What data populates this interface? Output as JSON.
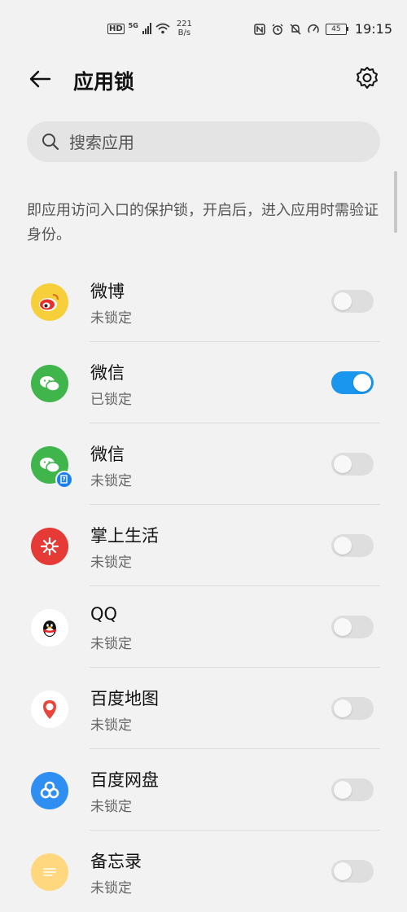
{
  "status_bar": {
    "hd": "HD",
    "network": "5G",
    "speed_value": "221",
    "speed_unit": "B/s",
    "battery": "45",
    "time": "19:15"
  },
  "header": {
    "title": "应用锁"
  },
  "search": {
    "placeholder": "搜索应用"
  },
  "description": "即应用访问入口的保护锁，开启后，进入应用时需验证身份。",
  "apps": [
    {
      "name": "微博",
      "status": "未锁定",
      "locked": false,
      "icon": "weibo-icon",
      "color": "#f6cf3a"
    },
    {
      "name": "微信",
      "status": "已锁定",
      "locked": true,
      "icon": "wechat-icon",
      "color": "#3fb54c"
    },
    {
      "name": "微信",
      "status": "未锁定",
      "locked": false,
      "icon": "wechat-clone-icon",
      "color": "#3fb54c"
    },
    {
      "name": "掌上生活",
      "status": "未锁定",
      "locked": false,
      "icon": "zhangshang-shenghuo-icon",
      "color": "#e53a36"
    },
    {
      "name": "QQ",
      "status": "未锁定",
      "locked": false,
      "icon": "qq-icon",
      "color": "#ffffff"
    },
    {
      "name": "百度地图",
      "status": "未锁定",
      "locked": false,
      "icon": "baidu-map-icon",
      "color": "#ffffff"
    },
    {
      "name": "百度网盘",
      "status": "未锁定",
      "locked": false,
      "icon": "baidu-netdisk-icon",
      "color": "#2f8ef2"
    },
    {
      "name": "备忘录",
      "status": "未锁定",
      "locked": false,
      "icon": "notes-icon",
      "color": "#ffd77e"
    }
  ],
  "colors": {
    "toggle_on": "#1a96ef",
    "toggle_off": "#dedede",
    "background": "#f2f2f2"
  }
}
